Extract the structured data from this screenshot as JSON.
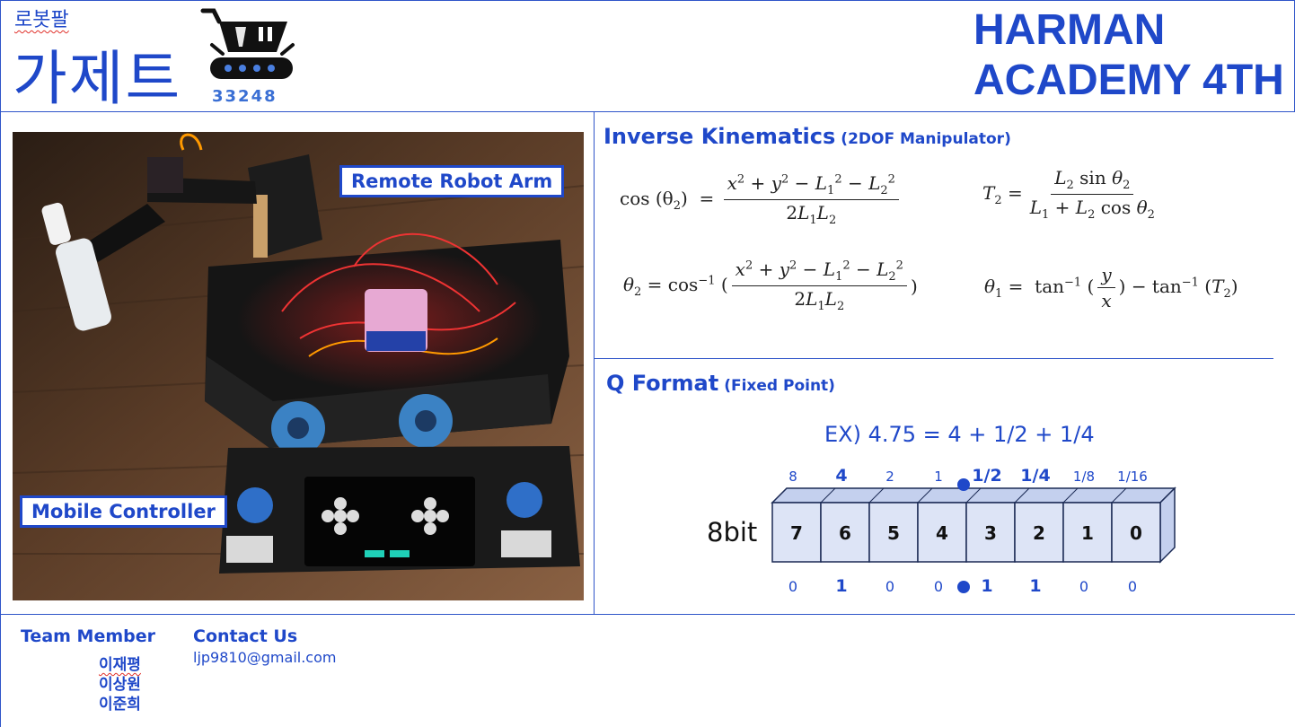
{
  "header": {
    "brand_small": "로봇팔",
    "brand_big": "가제트",
    "logo_number": "33248",
    "academy_line1": "HARMAN",
    "academy_line2": "ACADEMY 4TH"
  },
  "photo": {
    "callout_arm": "Remote Robot Arm",
    "callout_controller": "Mobile Controller"
  },
  "ik": {
    "title": "Inverse Kinematics",
    "subtitle": "(2DOF Manipulator)"
  },
  "qformat": {
    "title": "Q Format",
    "subtitle": "(Fixed Point)",
    "example": "EX) 4.75 = 4 + 1/2 + 1/4",
    "register_label": "8bit",
    "weights": [
      "8",
      "4",
      "2",
      "1",
      "1/2",
      "1/4",
      "1/8",
      "1/16"
    ],
    "bit_indices": [
      "7",
      "6",
      "5",
      "4",
      "3",
      "2",
      "1",
      "0"
    ],
    "bit_values": [
      "0",
      "1",
      "0",
      "0",
      "1",
      "1",
      "0",
      "0"
    ],
    "bold_positions": [
      1,
      4,
      5
    ]
  },
  "footer": {
    "team_label": "Team Member",
    "members": [
      "이재평",
      "이상원",
      "이준희"
    ],
    "contact_label": "Contact Us",
    "email": "ljp9810@gmail.com"
  },
  "colors": {
    "accent": "#1f48c9",
    "cube_face": "#dde4f6",
    "cube_side": "#c4d0ee"
  }
}
